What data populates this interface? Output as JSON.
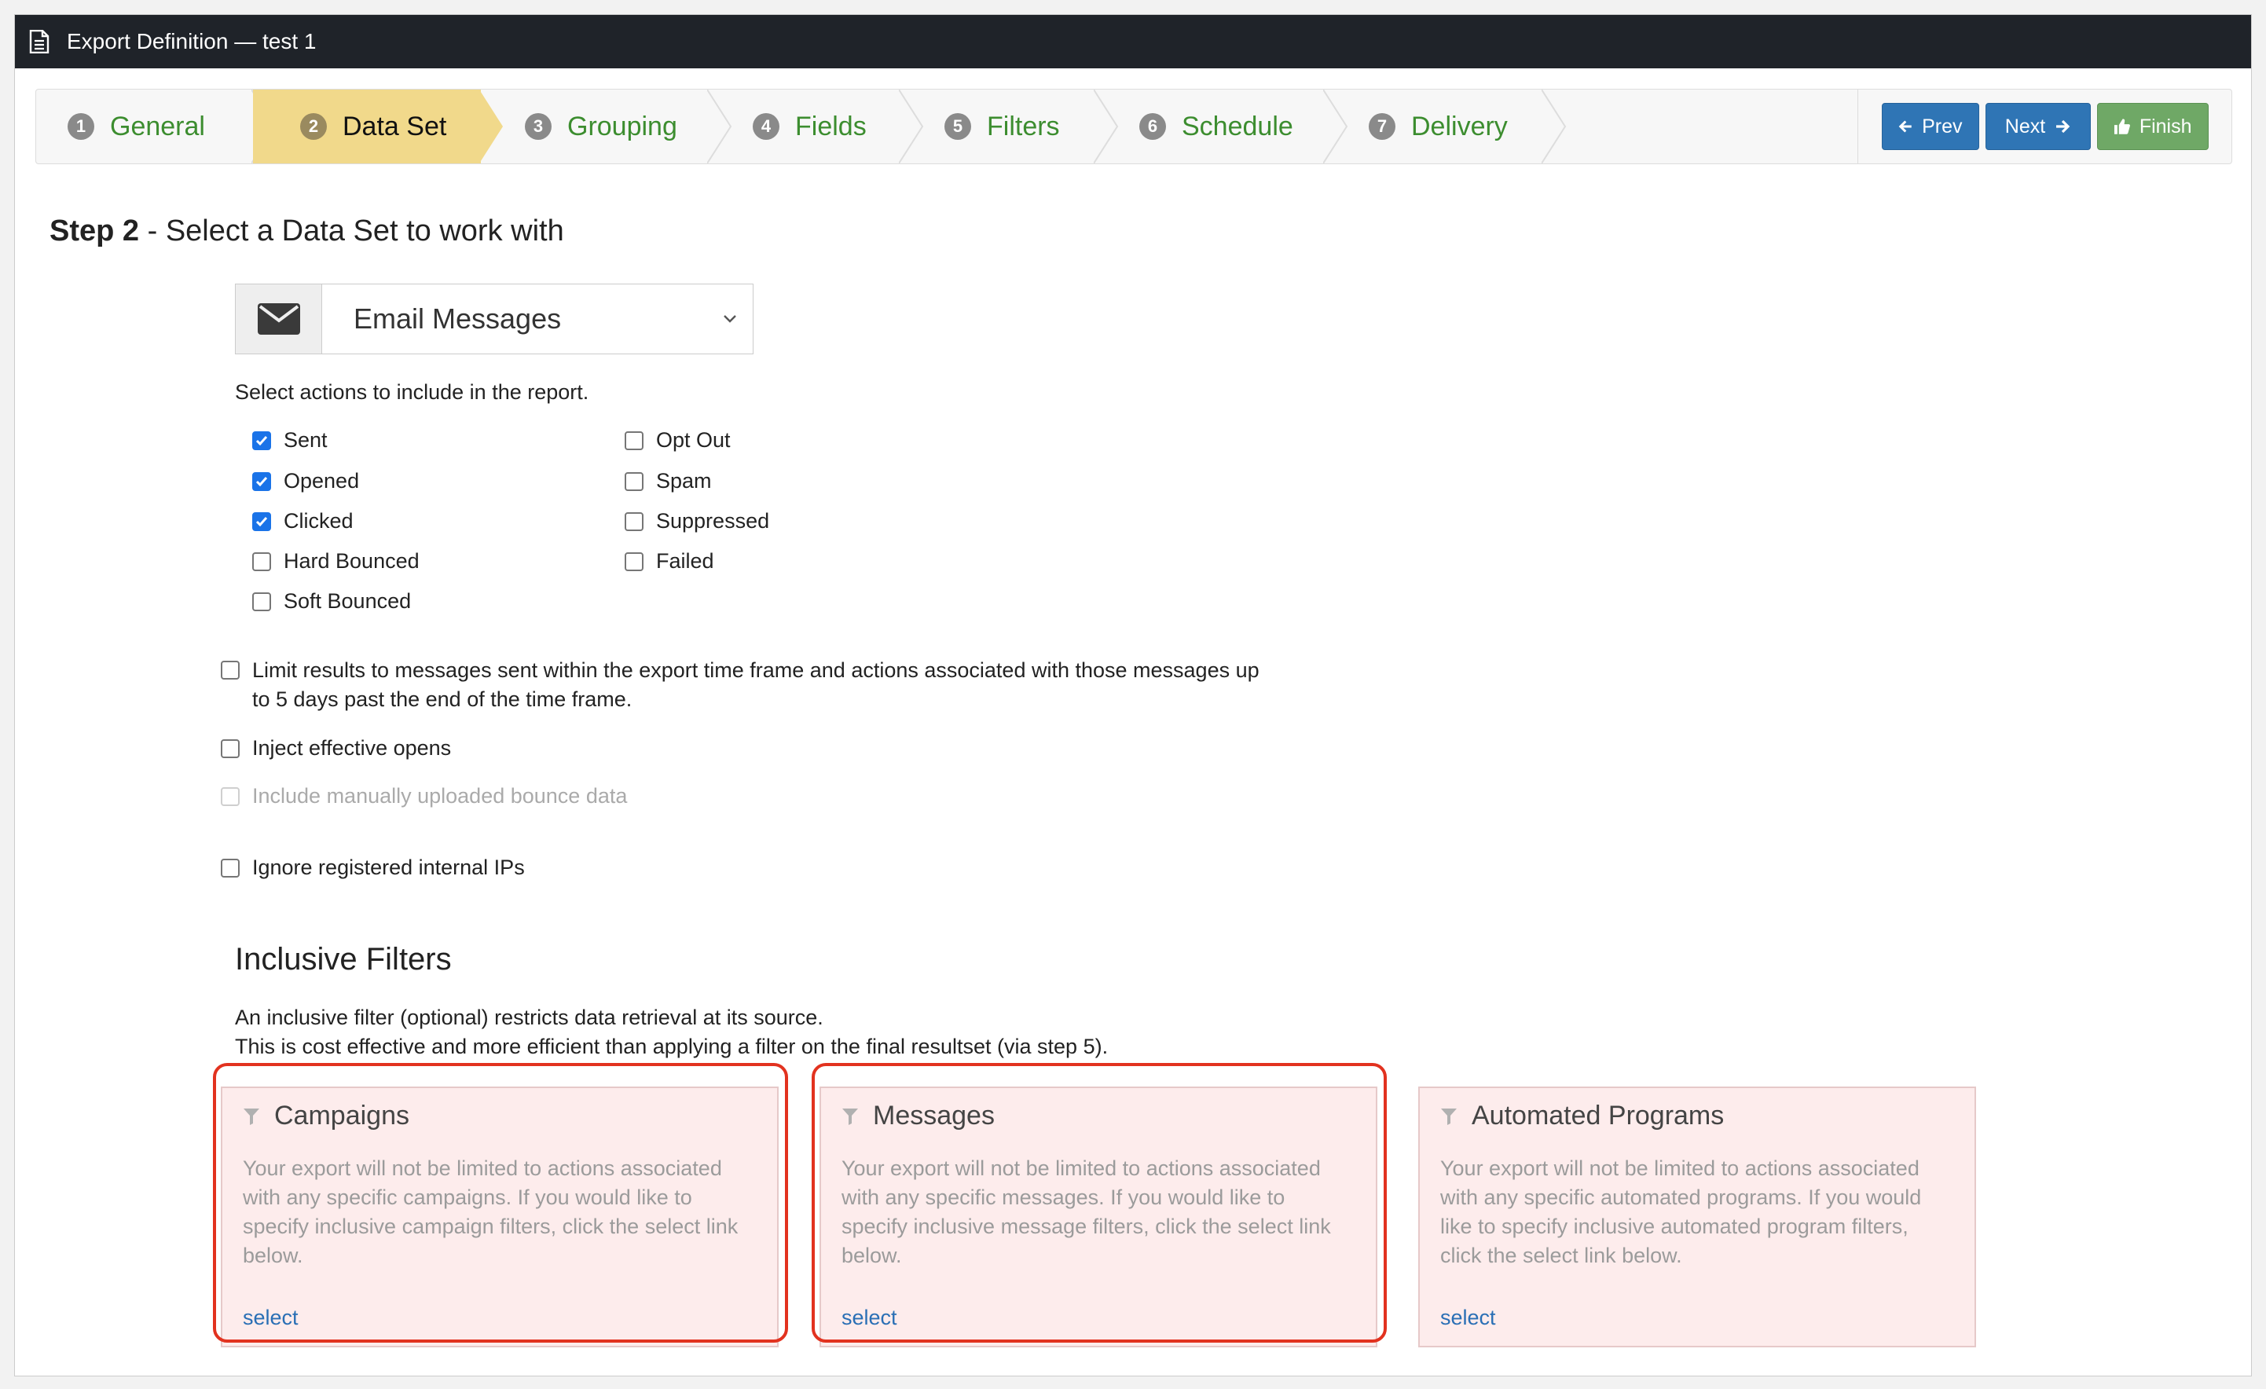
{
  "window": {
    "title": "Export Definition — test 1"
  },
  "wizard": {
    "steps": [
      {
        "num": "1",
        "label": "General"
      },
      {
        "num": "2",
        "label": "Data Set"
      },
      {
        "num": "3",
        "label": "Grouping"
      },
      {
        "num": "4",
        "label": "Fields"
      },
      {
        "num": "5",
        "label": "Filters"
      },
      {
        "num": "6",
        "label": "Schedule"
      },
      {
        "num": "7",
        "label": "Delivery"
      }
    ],
    "prev_label": "Prev",
    "next_label": "Next",
    "finish_label": "Finish"
  },
  "heading": {
    "step": "Step 2",
    "text": " - Select a Data Set to work with"
  },
  "dataset": {
    "selected": "Email Messages",
    "icon": "envelope-icon"
  },
  "actions_prompt": "Select actions to include in the report.",
  "actions": {
    "sent": {
      "label": "Sent",
      "checked": true
    },
    "opened": {
      "label": "Opened",
      "checked": true
    },
    "clicked": {
      "label": "Clicked",
      "checked": true
    },
    "hard_bounced": {
      "label": "Hard Bounced",
      "checked": false
    },
    "soft_bounced": {
      "label": "Soft Bounced",
      "checked": false
    },
    "opt_out": {
      "label": "Opt Out",
      "checked": false
    },
    "spam": {
      "label": "Spam",
      "checked": false
    },
    "suppressed": {
      "label": "Suppressed",
      "checked": false
    },
    "failed": {
      "label": "Failed",
      "checked": false
    }
  },
  "options": {
    "limit_line1": "Limit results to messages sent within the export time frame and actions associated with those messages up",
    "limit_line2": "to 5 days past the end of the time frame.",
    "inject": "Inject effective opens",
    "manual_bounce": "Include manually uploaded bounce data",
    "ignore_ips": "Ignore registered internal IPs"
  },
  "inclusive": {
    "title": "Inclusive Filters",
    "desc_line1": "An inclusive filter (optional) restricts data retrieval at its source.",
    "desc_line2": "This is cost effective and more efficient than applying a filter on the final resultset (via step 5).",
    "cards": {
      "campaigns": {
        "title": "Campaigns",
        "desc": "Your export will not be limited to actions associated with any specific campaigns. If you would like to specify inclusive campaign filters, click the select link below.",
        "select": "select"
      },
      "messages": {
        "title": "Messages",
        "desc": "Your export will not be limited to actions associated with any specific messages. If you would like to specify inclusive message filters, click the select link below.",
        "select": "select"
      },
      "programs": {
        "title": "Automated Programs",
        "desc": "Your export will not be limited to actions associated with any specific automated programs. If you would like to specify inclusive automated program filters, click the select link below.",
        "select": "select"
      }
    }
  },
  "colors": {
    "accent_blue": "#2f75b5",
    "finish_green": "#6fa866",
    "active_step": "#f1d98b",
    "highlight_red": "#e2321f"
  }
}
